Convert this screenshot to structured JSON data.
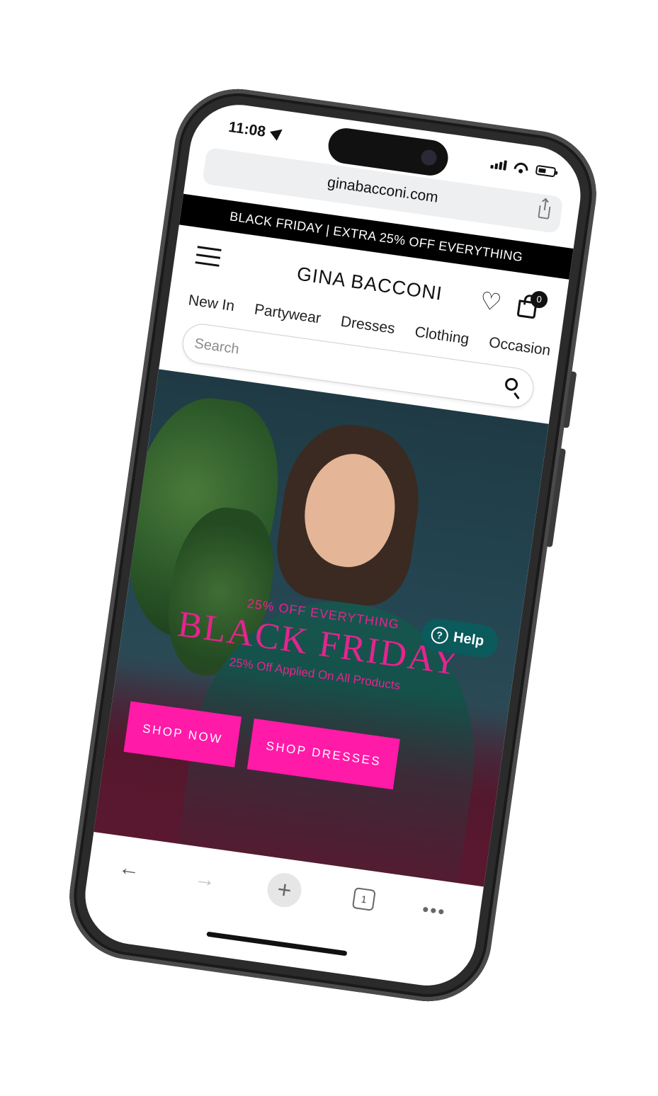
{
  "status_bar": {
    "time": "11:08",
    "icons": [
      "location-arrow-icon",
      "signal-icon",
      "wifi-icon",
      "battery-icon"
    ]
  },
  "browser": {
    "url": "ginabacconi.com",
    "toolbar_icons": [
      "back-arrow-icon",
      "forward-arrow-icon",
      "new-tab-plus-icon",
      "tabs-icon",
      "more-dots-icon"
    ],
    "tab_count": "1",
    "new_tab_symbol": "+",
    "back_symbol": "←",
    "forward_symbol": "→",
    "more_symbol": "•••"
  },
  "site": {
    "promo_banner": "BLACK FRIDAY | EXTRA 25% OFF EVERYTHING",
    "logo": "GINA BACCONI",
    "cart_count": "0",
    "heart_symbol": "♡",
    "nav": [
      "New In",
      "Partywear",
      "Dresses",
      "Clothing",
      "Occasion"
    ],
    "search": {
      "placeholder": "Search"
    },
    "hero": {
      "kicker": "25% OFF EVERYTHING",
      "title": "BLACK FRIDAY",
      "subtitle": "25% Off Applied On All Products",
      "buttons": [
        "SHOP NOW",
        "SHOP DRESSES"
      ]
    },
    "help": {
      "label": "Help",
      "icon_symbol": "?"
    }
  },
  "colors": {
    "accent_pink": "#ff1aa8",
    "hero_text_pink": "#e5248f",
    "help_teal": "#0b5a5c",
    "banner_black": "#000000"
  }
}
